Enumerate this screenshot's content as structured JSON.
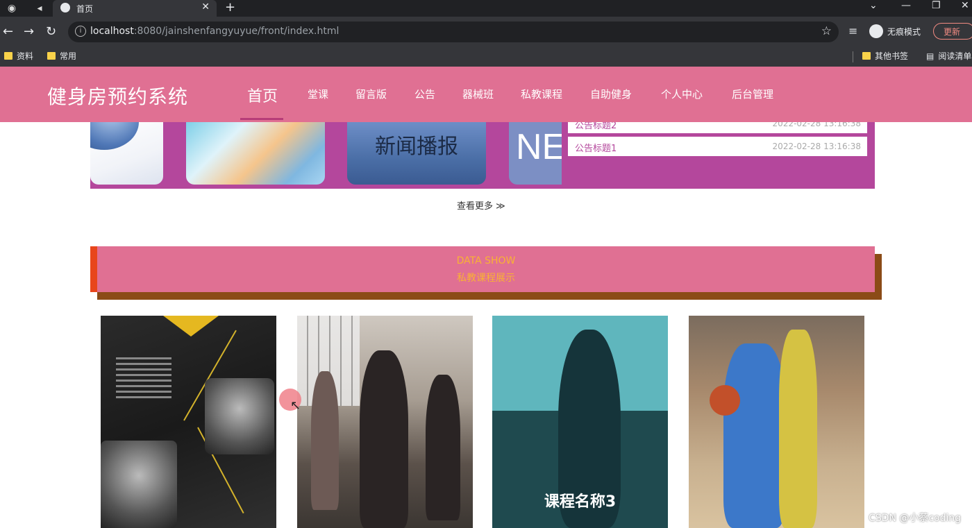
{
  "browser": {
    "tab_title": "首页",
    "url_host": "localhost",
    "url_rest": ":8080/jainshenfangyuyue/front/index.html",
    "incognito_label": "无痕模式",
    "update_label": "更新",
    "bookmarks": [
      "资料",
      "常用"
    ],
    "bookmarks_right": [
      "其他书签",
      "阅读清单"
    ]
  },
  "site": {
    "brand": "健身房预约系统",
    "menu": [
      "首页",
      "堂课",
      "留言版",
      "公告",
      "器械班",
      "私教课程",
      "自助健身",
      "个人中心",
      "后台管理"
    ]
  },
  "news": {
    "card_text_3": "新闻播报",
    "card_text_4": "NE",
    "notices": [
      {
        "title": "公告标题2",
        "date": "2022-02-28 13:16:38"
      },
      {
        "title": "公告标题1",
        "date": "2022-02-28 13:16:38"
      }
    ],
    "more_label": "查看更多 ≫"
  },
  "section": {
    "title_en": "DATA SHOW",
    "title_zh": "私教课程展示"
  },
  "courses": {
    "card3_name": "课程名称3"
  },
  "watermark": "CSDN @小蔡coding",
  "colors": {
    "header": "#e07093",
    "news_band": "#b4479c",
    "banner_accent": "#e8461c",
    "banner_text": "#f9b233"
  }
}
